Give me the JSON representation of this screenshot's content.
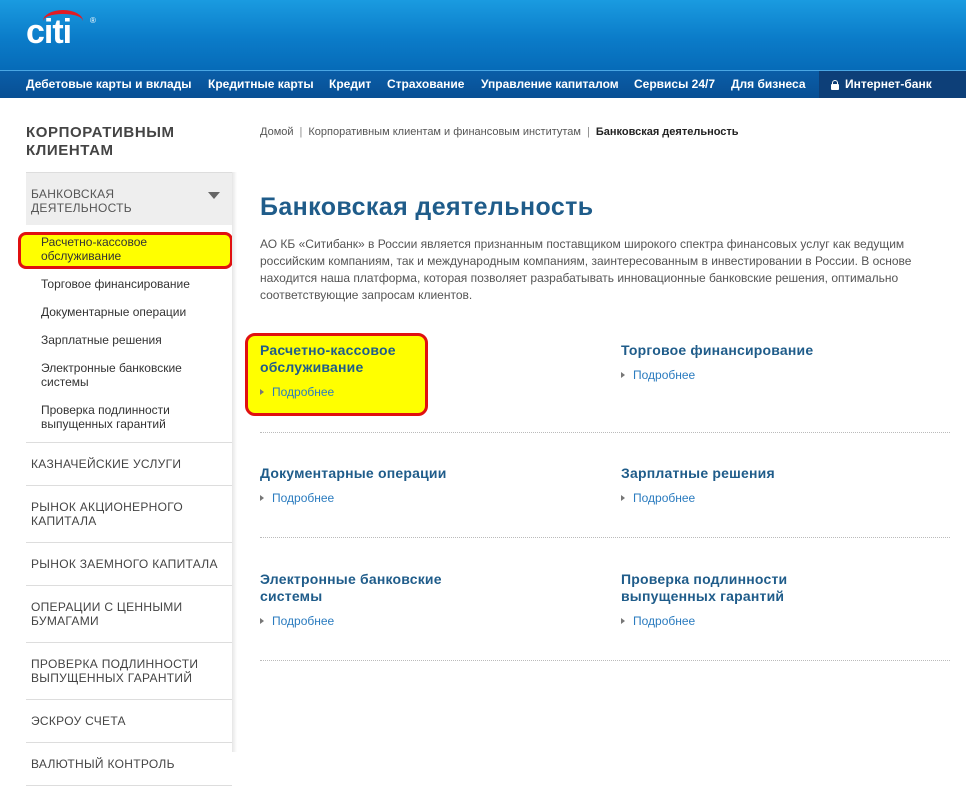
{
  "brand": {
    "logo": "citi",
    "logo_reg": "®",
    "accent": "#e31b23",
    "header_color": "#0b7cc9"
  },
  "nav": {
    "items": [
      {
        "label": "Дебетовые карты и вклады"
      },
      {
        "label": "Кредитные карты"
      },
      {
        "label": "Кредит"
      },
      {
        "label": "Страхование"
      },
      {
        "label": "Управление капиталом"
      },
      {
        "label": "Сервисы 24/7"
      },
      {
        "label": "Для бизнеса"
      }
    ],
    "internet_bank": "Интернет-банк"
  },
  "sidebar": {
    "title": "КОРПОРАТИВНЫМ КЛИЕНТАМ",
    "active_section": "БАНКОВСКАЯ ДЕЯТЕЛЬНОСТЬ",
    "sub_items": [
      "Расчетно-кассовое обслуживание",
      "Торговое финансирование",
      "Документарные операции",
      "Зарплатные решения",
      "Электронные банковские системы",
      "Проверка подлинности выпущенных гарантий"
    ],
    "sections": [
      "КАЗНАЧЕЙСКИЕ УСЛУГИ",
      "РЫНОК АКЦИОНЕРНОГО КАПИТАЛА",
      "РЫНОК ЗАЕМНОГО КАПИТАЛА",
      "ОПЕРАЦИИ С ЦЕННЫМИ БУМАГАМИ",
      "ПРОВЕРКА ПОДЛИННОСТИ ВЫПУЩЕННЫХ ГАРАНТИЙ",
      "ЭСКРОУ СЧЕТА",
      "ВАЛЮТНЫЙ КОНТРОЛЬ"
    ]
  },
  "breadcrumb": {
    "home": "Домой",
    "parent": "Корпоративным клиентам и финансовым институтам",
    "current": "Банковская деятельность",
    "separator": "|"
  },
  "main": {
    "title": "Банковская деятельность",
    "intro": "АО КБ «Ситибанк» в России является признанным поставщиком широкого спектра финансовых услуг как ведущим российским компаниям, так и международным компаниям, заинтересованным в инвестировании в России. В основе находится наша платформа, которая позволяет разрабатывать инновационные банковские решения, оптимально соответствующие запросам клиентов.",
    "cards": [
      {
        "title": "Расчетно-кассовое обслуживание",
        "link": "Подробнее"
      },
      {
        "title": "Торговое финансирование",
        "link": "Подробнее"
      },
      {
        "title": "Документарные операции",
        "link": "Подробнее"
      },
      {
        "title": "Зарплатные решения",
        "link": "Подробнее"
      },
      {
        "title": "Электронные банковские системы",
        "link": "Подробнее"
      },
      {
        "title": "Проверка подлинности выпущенных гарантий",
        "link": "Подробнее"
      }
    ]
  },
  "annotation_color": "#e01010",
  "highlight_color": "#ffff00"
}
